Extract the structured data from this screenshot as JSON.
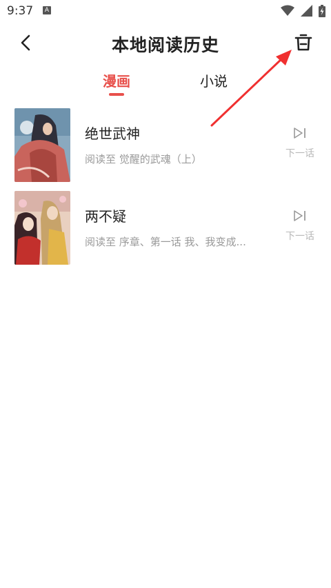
{
  "status_bar": {
    "time": "9:37",
    "notification_icon": "A"
  },
  "header": {
    "title": "本地阅读历史",
    "back_icon": "chevron-left-icon",
    "delete_icon": "trash-icon"
  },
  "tabs": [
    {
      "label": "漫画",
      "active": true
    },
    {
      "label": "小说",
      "active": false
    }
  ],
  "items": [
    {
      "title": "绝世武神",
      "progress": "阅读至 觉醒的武魂（上）",
      "next_label": "下一话"
    },
    {
      "title": "两不疑",
      "progress": "阅读至 序章、第一话 我、我变成...",
      "next_label": "下一话"
    }
  ],
  "colors": {
    "accent": "#e8504b",
    "title": "#222222",
    "secondary": "#9a9a9a",
    "muted": "#b8b8b8",
    "annotation_arrow": "#f03030"
  }
}
